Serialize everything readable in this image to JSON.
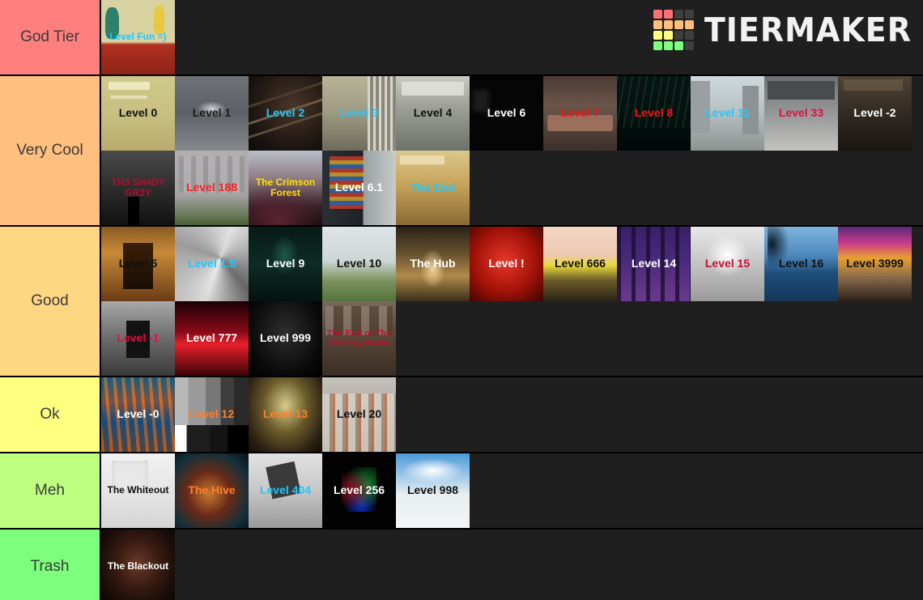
{
  "brand": {
    "name": "TIERMAKER",
    "logo_colors": [
      "#ff7070",
      "#ff7070",
      "#3f3f3f",
      "#3f3f3f",
      "#ffbe7d",
      "#ffbe7d",
      "#ffbe7d",
      "#ffbe7d",
      "#ffff7d",
      "#ffff7d",
      "#3f3f3f",
      "#3f3f3f",
      "#7dff7d",
      "#7dff7d",
      "#7dff7d",
      "#3f3f3f"
    ]
  },
  "page": {
    "background": "#1f1f1f"
  },
  "tiers": [
    {
      "label": "God Tier",
      "color": "#ff7f7f",
      "items": [
        {
          "label": "Level Fun =)",
          "text_color": "#1ec8ff",
          "bg": "bg-funroom",
          "size": "sm"
        }
      ]
    },
    {
      "label": "Very Cool",
      "color": "#ffbf7f",
      "items": [
        {
          "label": "Level 0",
          "text_color": "#111111",
          "bg": "bg-lvl0"
        },
        {
          "label": "Level 1",
          "text_color": "#1a1a1a",
          "bg": "bg-lvl1"
        },
        {
          "label": "Level 2",
          "text_color": "#1ec8ff",
          "bg": "bg-lvl2"
        },
        {
          "label": "Level 3",
          "text_color": "#1ec8ff",
          "bg": "bg-lvl3"
        },
        {
          "label": "Level 4",
          "text_color": "#111111",
          "bg": "bg-lvl4"
        },
        {
          "label": "Level 6",
          "text_color": "#ffffff",
          "bg": "bg-lvl6"
        },
        {
          "label": "Level 7",
          "text_color": "#ff1111",
          "bg": "bg-lvl7"
        },
        {
          "label": "Level 8",
          "text_color": "#ff1111",
          "bg": "bg-lvl8"
        },
        {
          "label": "Level 11",
          "text_color": "#1ec8ff",
          "bg": "bg-lvl11"
        },
        {
          "label": "Level 33",
          "text_color": "#e01040",
          "bg": "bg-lvl33"
        },
        {
          "label": "Level -2",
          "text_color": "#ffffff",
          "bg": "bg-lvlm2"
        },
        {
          "label": "TH3 SH4DY GR3Y",
          "text_color": "#b01030",
          "bg": "bg-shady",
          "size": "sm"
        },
        {
          "label": "Level 188",
          "text_color": "#ff2020",
          "bg": "bg-lvl188"
        },
        {
          "label": "The Crimson Forest",
          "text_color": "#ffe000",
          "bg": "bg-crimson",
          "size": "sm"
        },
        {
          "label": "Level 6.1",
          "text_color": "#ffffff",
          "bg": "bg-lvl61"
        },
        {
          "label": "The End",
          "text_color": "#1ec8ff",
          "bg": "bg-theend"
        }
      ]
    },
    {
      "label": "Good",
      "color": "#ffd782",
      "items": [
        {
          "label": "Level 5",
          "text_color": "#111111",
          "bg": "bg-lvl5"
        },
        {
          "label": "Level 1.5",
          "text_color": "#1ec8ff",
          "bg": "bg-lvl15b"
        },
        {
          "label": "Level 9",
          "text_color": "#ffffff",
          "bg": "bg-lvl9"
        },
        {
          "label": "Level 10",
          "text_color": "#111111",
          "bg": "bg-lvl10"
        },
        {
          "label": "The Hub",
          "text_color": "#ffffff",
          "bg": "bg-hub"
        },
        {
          "label": "Level !",
          "text_color": "#ffffff",
          "bg": "bg-lvlexcl"
        },
        {
          "label": "Level 666",
          "text_color": "#111111",
          "bg": "bg-lvl666"
        },
        {
          "label": "Level 14",
          "text_color": "#ffffff",
          "bg": "bg-lvl14"
        },
        {
          "label": "Level 15",
          "text_color": "#c01030",
          "bg": "bg-lvl15"
        },
        {
          "label": "Level 16",
          "text_color": "#111111",
          "bg": "bg-lvl16"
        },
        {
          "label": "Level 3999",
          "text_color": "#111111",
          "bg": "bg-lvl3999"
        },
        {
          "label": "Level -1",
          "text_color": "#e01040",
          "bg": "bg-lvlm1"
        },
        {
          "label": "Level 777",
          "text_color": "#ffffff",
          "bg": "bg-lvl777"
        },
        {
          "label": "Level 999",
          "text_color": "#ffffff",
          "bg": "bg-lvl999"
        },
        {
          "label": "The End of The F#c*ing World",
          "text_color": "#c01030",
          "bg": "bg-endworld",
          "size": "xs"
        }
      ]
    },
    {
      "label": "Ok",
      "color": "#ffff80",
      "items": [
        {
          "label": "Level -0",
          "text_color": "#ffffff",
          "bg": "bg-lvlm0"
        },
        {
          "label": "Level 12",
          "text_color": "#ff7f28",
          "bg": "bg-lvl12"
        },
        {
          "label": "Level 13",
          "text_color": "#ff7f28",
          "bg": "bg-lvl13"
        },
        {
          "label": "Level 20",
          "text_color": "#111111",
          "bg": "bg-lvl20"
        }
      ]
    },
    {
      "label": "Meh",
      "color": "#bfff80",
      "items": [
        {
          "label": "The Whiteout",
          "text_color": "#111111",
          "bg": "bg-whiteout",
          "size": "sm"
        },
        {
          "label": "The Hive",
          "text_color": "#ff7f28",
          "bg": "bg-hive"
        },
        {
          "label": "Level 404",
          "text_color": "#1ec8ff",
          "bg": "bg-lvl404"
        },
        {
          "label": "Level 256",
          "text_color": "#ffffff",
          "bg": "bg-lvl256"
        },
        {
          "label": "Level 998",
          "text_color": "#111111",
          "bg": "bg-lvl998"
        }
      ]
    },
    {
      "label": "Trash",
      "color": "#7dff7d",
      "items": [
        {
          "label": "The Blackout",
          "text_color": "#ffffff",
          "bg": "bg-blackout",
          "size": "sm"
        }
      ]
    }
  ]
}
